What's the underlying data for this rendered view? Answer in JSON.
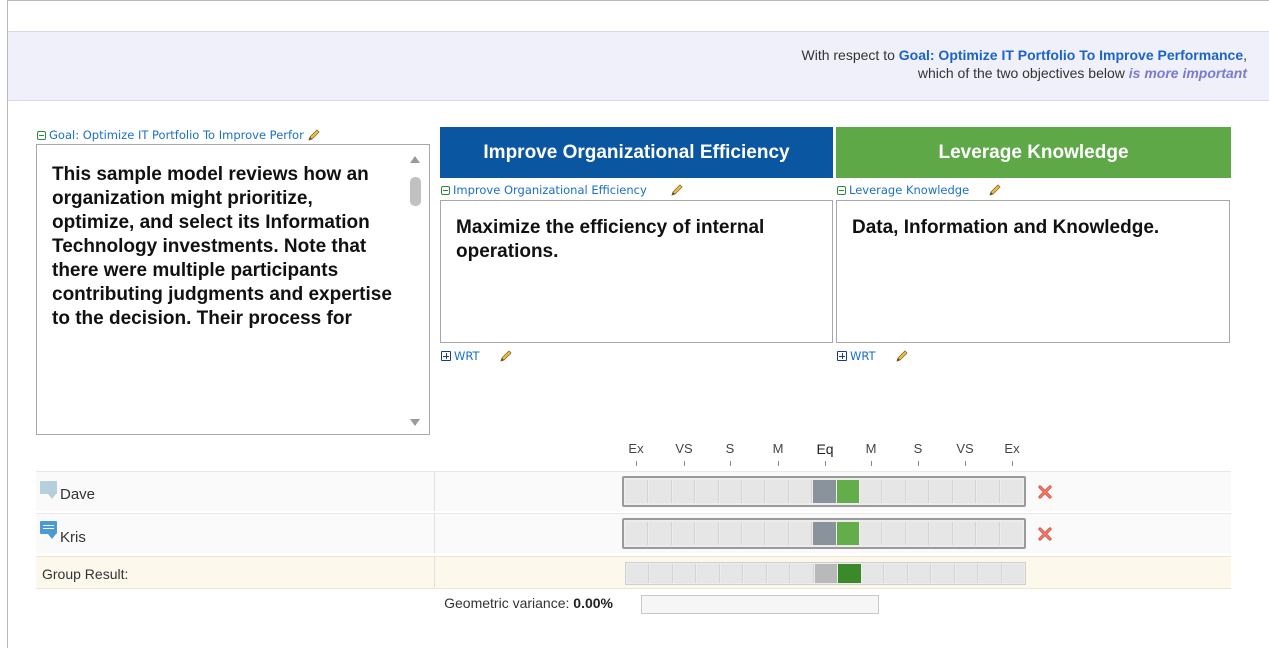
{
  "banner": {
    "prefix": "With respect to",
    "goal_link": "Goal: Optimize IT Portfolio To Improve Performance",
    "comma": ",",
    "line2_prefix": "which of the two objectives below",
    "line2_emph": "is more important"
  },
  "goal": {
    "label": "Goal: Optimize IT Portfolio To Improve Perfor",
    "description": "This sample model reviews how an organization might prioritize, optimize, and select its Information Technology investments.  Note that there were multiple participants contributing judgments and expertise to the decision.  Their process for"
  },
  "objectives": {
    "left": {
      "header": "Improve Organizational Efficiency",
      "label": "Improve Organizational Efficiency",
      "description": "Maximize the efficiency of internal operations.",
      "wrt": "WRT",
      "color": "#0b56a0"
    },
    "right": {
      "header": "Leverage Knowledge",
      "label": "Leverage Knowledge",
      "description": "Data, Information and Knowledge.",
      "wrt": "WRT",
      "color": "#5fa848"
    }
  },
  "scale": {
    "labels": [
      "Ex",
      "VS",
      "S",
      "M",
      "Eq",
      "M",
      "S",
      "VS",
      "Ex"
    ]
  },
  "judgments": [
    {
      "name": "Dave",
      "selected_cell": 9,
      "selected_color": "green"
    },
    {
      "name": "Kris",
      "selected_cell": 9,
      "selected_color": "green"
    }
  ],
  "group": {
    "label": "Group Result:",
    "selected_cell": 9
  },
  "variance": {
    "label": "Geometric variance:",
    "value": "0.00%"
  },
  "icons": {
    "collapse": "minus-box-icon",
    "expand": "plus-box-icon",
    "edit": "pencil-icon",
    "delete": "red-x-icon",
    "comment": "comment-bubble-icon"
  }
}
